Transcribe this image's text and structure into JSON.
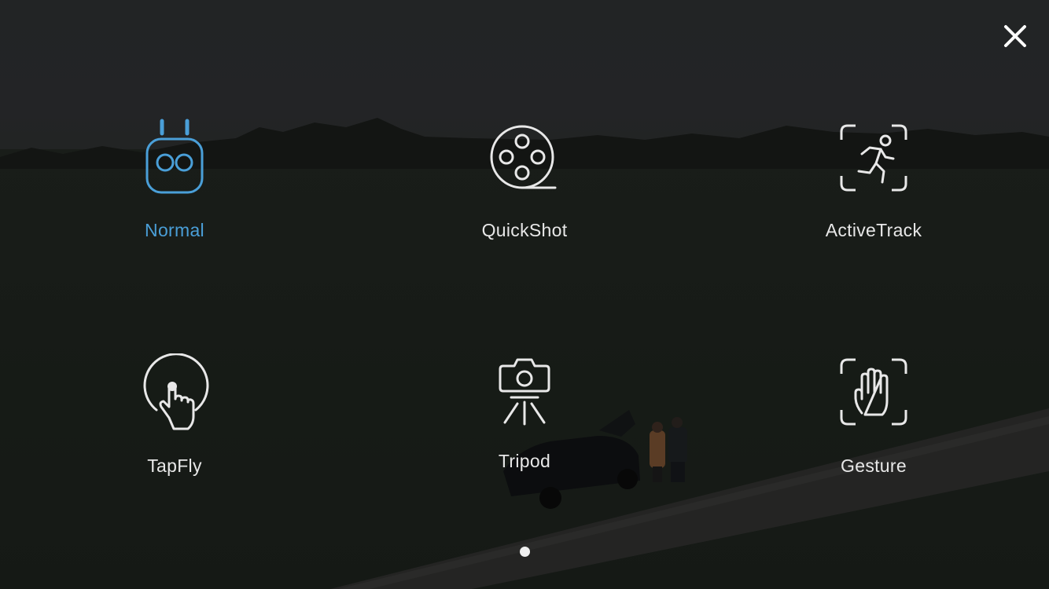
{
  "header": {
    "close_icon": "close-icon"
  },
  "modes": [
    {
      "label": "Normal",
      "icon": "remote-controller-icon",
      "active": true,
      "accent": "#4a9fd8"
    },
    {
      "label": "QuickShot",
      "icon": "film-reel-icon",
      "active": false
    },
    {
      "label": "ActiveTrack",
      "icon": "running-person-icon",
      "active": false
    },
    {
      "label": "TapFly",
      "icon": "tap-finger-icon",
      "active": false
    },
    {
      "label": "Tripod",
      "icon": "camera-tripod-icon",
      "active": false
    },
    {
      "label": "Gesture",
      "icon": "hand-gesture-icon",
      "active": false
    }
  ],
  "pagination": {
    "pages": 1,
    "current": 1
  },
  "colors": {
    "accent": "#4a9fd8",
    "label": "#e8e8e8"
  }
}
